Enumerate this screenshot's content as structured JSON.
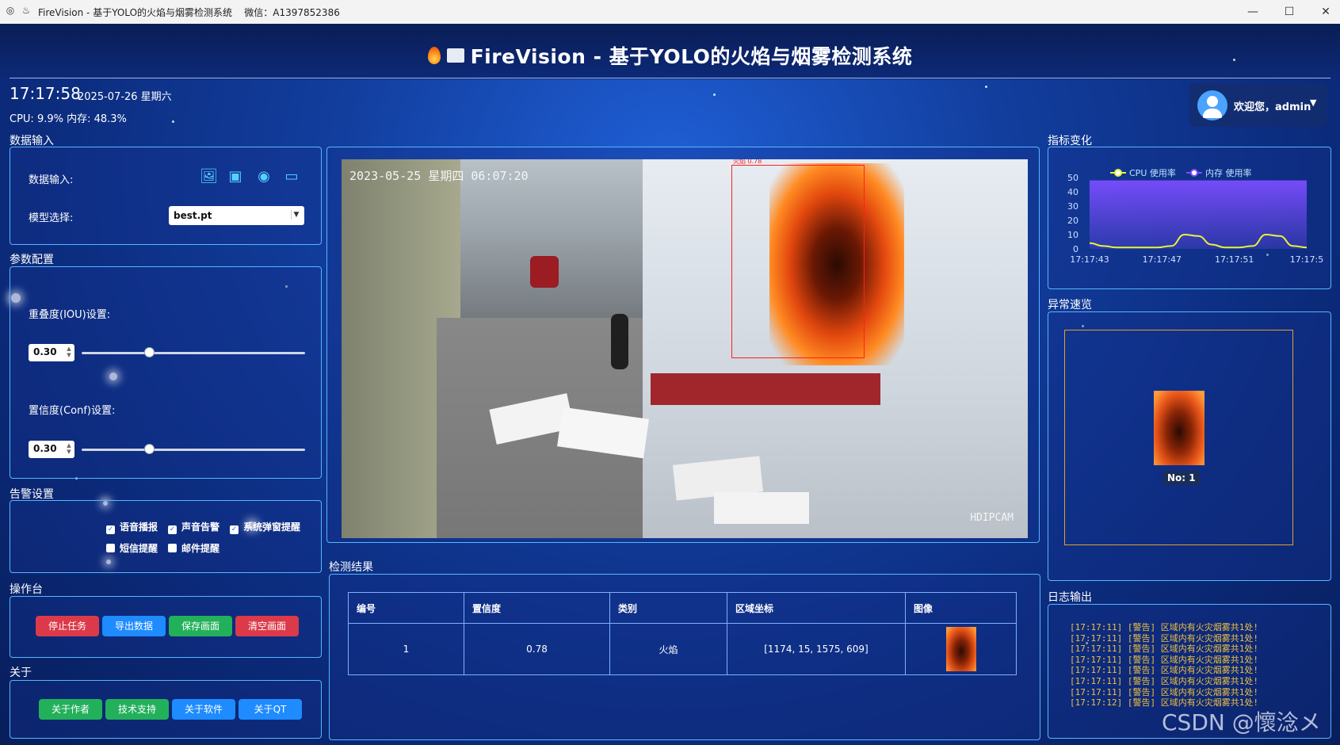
{
  "window": {
    "title": "FireVision - 基于YOLO的火焰与烟雾检测系统",
    "wechat": "微信：A1397852386",
    "min": "—",
    "max": "☐",
    "close": "✕"
  },
  "header": {
    "title": "FireVision - 基于YOLO的火焰与烟雾检测系统",
    "time": "17:17:58",
    "date": "2025-07-26 星期六",
    "sysinfo": "CPU: 9.9%  内存: 48.3%"
  },
  "user": {
    "greeting": "欢迎您，admin",
    "menu_icon": "caret-down-icon"
  },
  "input_panel": {
    "section": "数据输入",
    "input_label": "数据输入:",
    "icons": [
      "image-file-icon",
      "video-file-icon",
      "camera-icon",
      "screen-capture-icon"
    ],
    "model_label": "模型选择:",
    "model_value": "best.pt"
  },
  "params": {
    "section": "参数配置",
    "iou_label": "重叠度(IOU)设置:",
    "iou_value": "0.30",
    "iou_fraction": 0.3,
    "conf_label": "置信度(Conf)设置:",
    "conf_value": "0.30",
    "conf_fraction": 0.3
  },
  "alerts": {
    "section": "告警设置",
    "options": [
      {
        "label": "语音播报",
        "checked": true
      },
      {
        "label": "声音告警",
        "checked": true
      },
      {
        "label": "系统弹窗提醒",
        "checked": true
      },
      {
        "label": "短信提醒",
        "checked": false
      },
      {
        "label": "邮件提醒",
        "checked": false
      }
    ]
  },
  "console": {
    "section": "操作台",
    "stop": "停止任务",
    "export": "导出数据",
    "save": "保存画面",
    "clear": "清空画面"
  },
  "about": {
    "section": "关于",
    "author": "关于作者",
    "support": "技术支持",
    "software": "关于软件",
    "qt": "关于QT"
  },
  "video": {
    "timestamp": "2023-05-25 星期四 06:07:20",
    "cam_label": "HDIPCAM",
    "bbox_label": "火焰 0.78"
  },
  "results": {
    "section": "检测结果",
    "columns": [
      "编号",
      "置信度",
      "类别",
      "区域坐标",
      "图像"
    ],
    "rows": [
      [
        "1",
        "0.78",
        "火焰",
        "[1174, 15, 1575, 609]"
      ]
    ]
  },
  "metrics": {
    "section": "指标变化",
    "chart_data": {
      "type": "line",
      "series": [
        {
          "name": "CPU 使用率",
          "color": "#e7f23a",
          "values": [
            4,
            2,
            1,
            1,
            1,
            1,
            2,
            10,
            9,
            3,
            1,
            1,
            2,
            10,
            9,
            2,
            1
          ]
        },
        {
          "name": "内存 使用率",
          "color": "#7b4dff",
          "values": [
            48,
            48,
            48,
            48,
            48,
            48,
            48,
            48,
            48,
            48,
            48,
            48,
            48,
            48,
            48,
            48,
            48
          ]
        }
      ],
      "x_ticks": [
        "17:17:43",
        "17:17:47",
        "17:17:51",
        "17:17:5"
      ],
      "y_ticks": [
        "0",
        "10",
        "20",
        "30",
        "40",
        "50"
      ],
      "ylim": [
        0,
        50
      ],
      "legend": "top"
    }
  },
  "anomaly": {
    "section": "异常速览",
    "no_label": "No: 1"
  },
  "log": {
    "section": "日志输出",
    "lines": [
      "[17:17:11] [警告] 区域内有火灾烟雾共1处!",
      "[17:17:11] [警告] 区域内有火灾烟雾共1处!",
      "[17:17:11] [警告] 区域内有火灾烟雾共1处!",
      "[17:17:11] [警告] 区域内有火灾烟雾共1处!",
      "[17:17:11] [警告] 区域内有火灾烟雾共1处!",
      "[17:17:11] [警告] 区域内有火灾烟雾共1处!",
      "[17:17:11] [警告] 区域内有火灾烟雾共1处!",
      "[17:17:12] [警告] 区域内有火灾烟雾共1处!",
      "[17:17:12] [警告] 区域内有火灾烟雾共1处!"
    ]
  },
  "watermark": "CSDN @懷淰メ"
}
